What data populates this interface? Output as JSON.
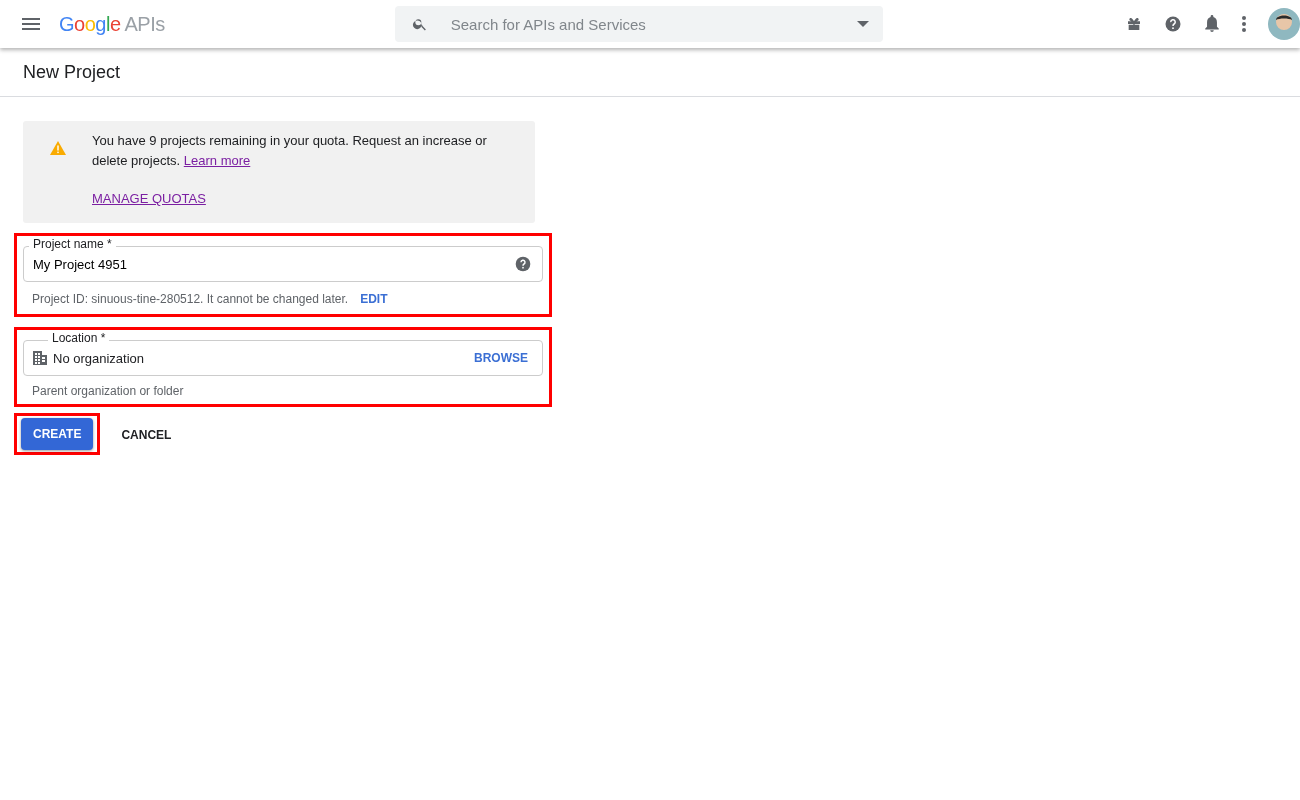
{
  "header": {
    "logo": {
      "brand": "Google",
      "product": "APIs"
    },
    "search": {
      "placeholder": "Search for APIs and Services"
    }
  },
  "page_title": "New Project",
  "notice": {
    "text": "You have 9 projects remaining in your quota. Request an increase or delete projects.",
    "link": "Learn more",
    "action": "MANAGE QUOTAS"
  },
  "project_name": {
    "label": "Project name *",
    "value": "My Project 4951",
    "hint": "Project ID: sinuous-tine-280512. It cannot be changed later.",
    "hint_action": "EDIT",
    "highlighted": true
  },
  "location": {
    "label": "Location *",
    "value": "No organization",
    "action": "BROWSE",
    "hint": "Parent organization or folder",
    "highlighted": true
  },
  "buttons": [
    {
      "label": "CREATE",
      "kind": "primary",
      "highlighted": true
    },
    {
      "label": "CANCEL",
      "kind": "text",
      "highlighted": false
    }
  ]
}
